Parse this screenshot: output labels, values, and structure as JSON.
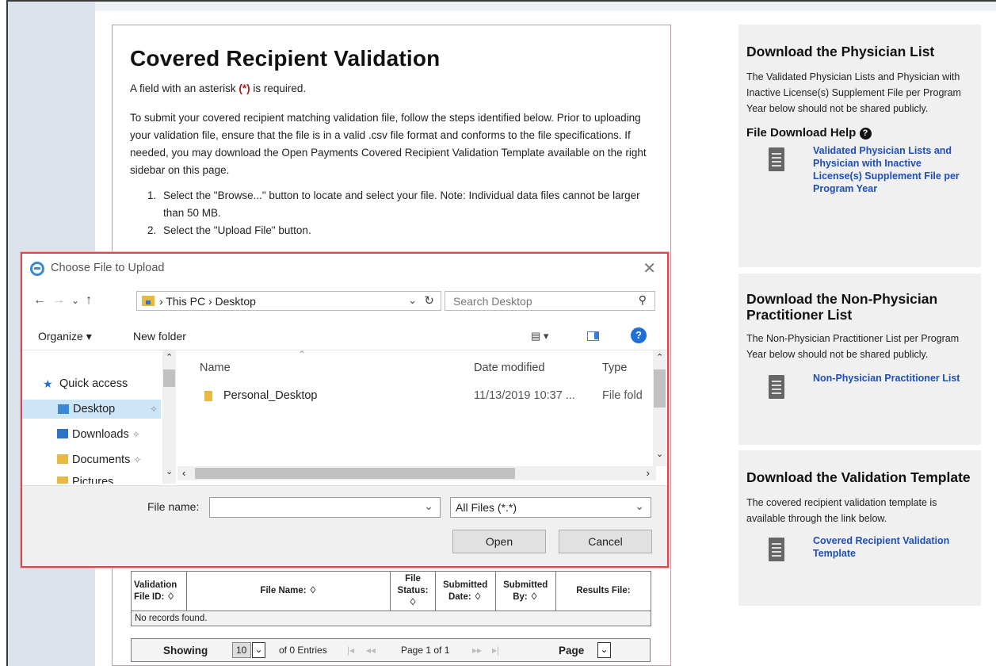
{
  "page": {
    "title": "Covered Recipient Validation",
    "required_note_prefix": "A field with an asterisk ",
    "required_note_asterisk": "(*)",
    "required_note_suffix": " is required.",
    "intro": "To submit your covered recipient matching validation file, follow the steps identified below. Prior to uploading your validation file, ensure that the file is in a valid .csv file format and conforms to the file specifications. If needed, you may download the Open Payments Covered Recipient Validation Template available on the right sidebar on this page.",
    "steps": [
      {
        "num": "1.",
        "text": "Select the \"Browse...\" button to locate and select your file. Note: Individual data files cannot be larger than 50 MB."
      },
      {
        "num": "2.",
        "text": "Select the \"Upload File\" button."
      }
    ]
  },
  "table": {
    "headers": [
      "Validation File ID: ♢",
      "File Name: ♢",
      "File Status: ♢",
      "Submitted Date: ♢",
      "Submitted By: ♢",
      "Results File:"
    ],
    "empty_message": "No records found.",
    "pager": {
      "showing_label": "Showing",
      "page_size": "10",
      "entries": "of 0 Entries",
      "first": "|◂",
      "prev": "◂◂",
      "page_info": "Page 1 of 1",
      "next": "▸▸",
      "last": "▸|",
      "page_label": "Page"
    }
  },
  "sidebar": {
    "physician": {
      "title": "Download the Physician List",
      "text": "The Validated Physician Lists and Physician with Inactive License(s) Supplement File per Program Year below should not be shared publicly.",
      "help_title": "File Download Help",
      "help_icon": "?",
      "link": "Validated Physician Lists and Physician with Inactive License(s) Supplement File per Program Year"
    },
    "nonphysician": {
      "title": "Download the Non-Physician Practitioner List",
      "text": "The Non-Physician Practitioner List per Program Year below should not be shared publicly.",
      "link": "Non-Physician Practitioner List"
    },
    "template": {
      "title": "Download the Validation Template",
      "text": "The covered recipient validation template is available through the link below.",
      "link": "Covered Recipient Validation Template"
    }
  },
  "dialog": {
    "title": "Choose File to Upload",
    "close": "✕",
    "nav": {
      "back": "←",
      "forward": "→",
      "recent": "⌄",
      "up": "↑"
    },
    "address": "This PC  ›  Desktop",
    "address_prefix": "›",
    "search_placeholder": "Search Desktop",
    "toolbar": {
      "organize": "Organize ▾",
      "new_folder": "New folder",
      "view": "▤  ▾",
      "help": "?"
    },
    "tree": [
      {
        "label": "Quick access",
        "icon": "star-icon"
      },
      {
        "label": "Desktop",
        "icon": "desktop-folder-icon",
        "selected": true
      },
      {
        "label": "Downloads",
        "icon": "downloads-folder-icon"
      },
      {
        "label": "Documents",
        "icon": "documents-folder-icon"
      },
      {
        "label": "Pictures",
        "icon": "pictures-folder-icon"
      }
    ],
    "columns": {
      "name": "Name",
      "date": "Date modified",
      "type": "Type"
    },
    "files": [
      {
        "name": "Personal_Desktop",
        "date": "11/13/2019 10:37 ...",
        "type": "File fold"
      }
    ],
    "file_name_label": "File name:",
    "file_name_value": "",
    "file_type": "All Files (*.*)",
    "open": "Open",
    "cancel": "Cancel"
  },
  "colors": {
    "link": "#1f4fb7",
    "asterisk": "#a31f24",
    "dialog_border": "#e0454b",
    "selected": "#cde6f7"
  }
}
